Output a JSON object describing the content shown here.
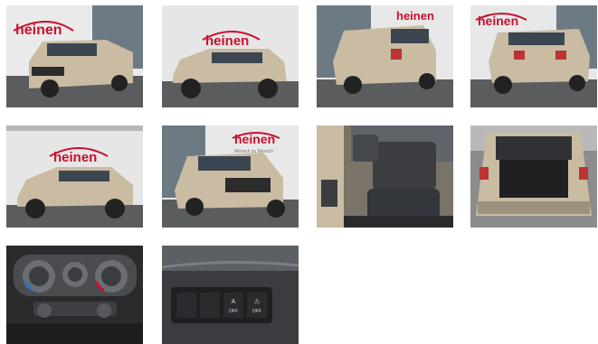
{
  "gallery": {
    "brand_text": "heinen",
    "brand_subtext": "Mensch zu Mensch",
    "button_labels": {
      "a": "A",
      "off": "OFF"
    },
    "colors": {
      "car_body": "#c9bca3",
      "dealer_red": "#c8102e",
      "asphalt": "#5a5c5e",
      "interior": "#3b3d40"
    },
    "photos": [
      {
        "view": "front-left exterior"
      },
      {
        "view": "left side exterior"
      },
      {
        "view": "rear-left exterior"
      },
      {
        "view": "rear exterior"
      },
      {
        "view": "left profile exterior"
      },
      {
        "view": "front exterior"
      },
      {
        "view": "rear seats interior"
      },
      {
        "view": "open trunk"
      },
      {
        "view": "climate control panel"
      },
      {
        "view": "dashboard switch panel"
      }
    ]
  }
}
